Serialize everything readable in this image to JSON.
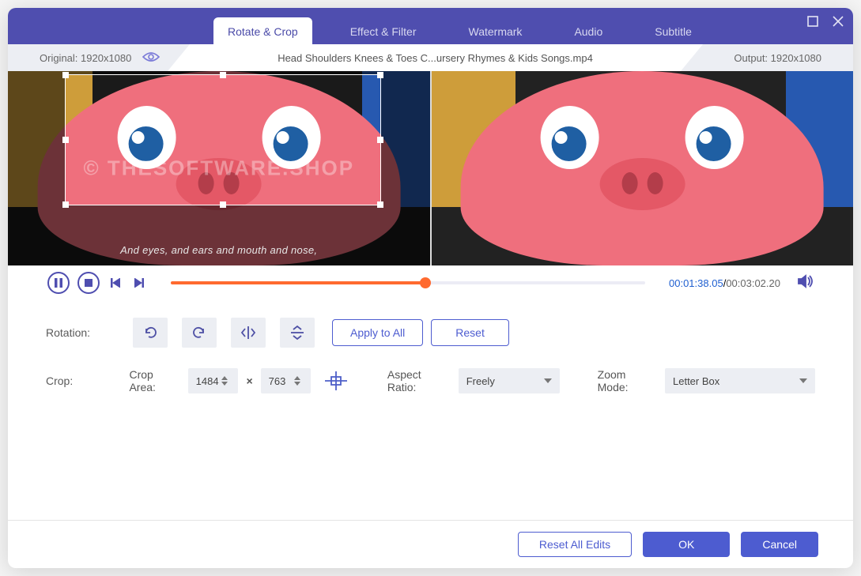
{
  "tabs": [
    "Rotate & Crop",
    "Effect & Filter",
    "Watermark",
    "Audio",
    "Subtitle"
  ],
  "active_tab": 0,
  "infobar": {
    "original": "Original: 1920x1080",
    "title": "Head Shoulders Knees & Toes  C...ursery Rhymes & Kids Songs.mp4",
    "output": "Output: 1920x1080"
  },
  "preview_subtitle": "And eyes, and ears and mouth and nose,",
  "watermark_text": "© THESOFTWARE.SHOP",
  "play": {
    "current": "00:01:38.05",
    "total": "00:03:02.20",
    "progress_pct": 53.7
  },
  "rotation": {
    "label": "Rotation:",
    "apply_all": "Apply to All",
    "reset": "Reset"
  },
  "crop": {
    "label": "Crop:",
    "area_label": "Crop Area:",
    "w": "1484",
    "h": "763",
    "aspect_label": "Aspect Ratio:",
    "aspect_value": "Freely",
    "zoom_label": "Zoom Mode:",
    "zoom_value": "Letter Box"
  },
  "footer": {
    "reset_all": "Reset All Edits",
    "ok": "OK",
    "cancel": "Cancel"
  }
}
